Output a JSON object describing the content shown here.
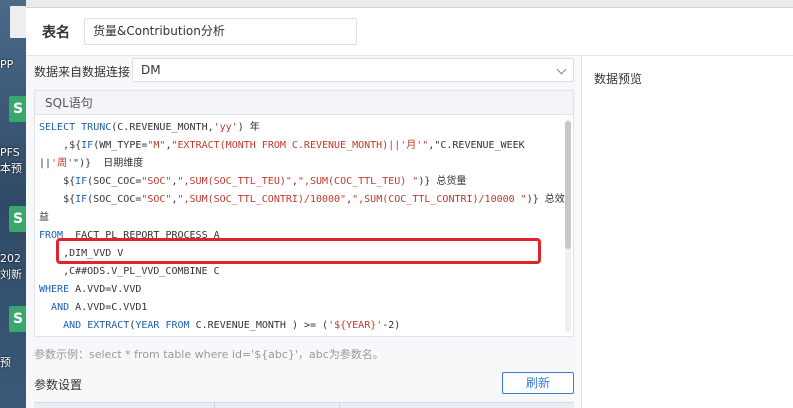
{
  "desktop": {
    "labels": [
      "PP",
      "PFS",
      "本预",
      "202",
      "刘新",
      "预"
    ]
  },
  "dialog": {
    "name_label": "表名",
    "name_value": "货量&Contribution分析",
    "connection_label": "数据来自数据连接",
    "connection_value": "DM",
    "sql_title": "SQL语句",
    "preview_title": "数据预览",
    "param_hint": "参数示例：select * from table where id='${abc}'，abc为参数名。",
    "params_label": "参数设置",
    "refresh_label": "刷新"
  },
  "sql_lines": [
    "SELECT TRUNC(C.REVENUE_MONTH,'yy') 年",
    "    ,${IF(WM_TYPE=\"M\",\"EXTRACT(MONTH FROM C.REVENUE_MONTH)||'月'\",\"C.REVENUE_WEEK",
    "||'周'\")}  日期维度",
    "    ${IF(SOC_COC=\"SOC\",\",SUM(SOC_TTL_TEU)\",\",SUM(COC_TTL_TEU) \")} 总货量",
    "    ${IF(SOC_COC=\"SOC\",\",SUM(SOC_TTL_CONTRI)/10000\",\",SUM(COC_TTL_CONTRI)/10000 \")} 总效",
    "益",
    "FROM  FACT_PL_REPORT_PROCESS A",
    "    ,DIM_VVD V",
    "    ,C##ODS.V_PL_VVD_COMBINE C",
    "WHERE A.VVD=V.VVD",
    "  AND A.VVD=C.VVD1",
    "    AND EXTRACT(YEAR FROM C.REVENUE_MONTH ) >= ('${YEAR}'-2)"
  ],
  "colors": {
    "highlight": "#e0242c",
    "keyword": "#1f5fb0",
    "string": "#c0392b",
    "accent": "#3a7bd5"
  }
}
